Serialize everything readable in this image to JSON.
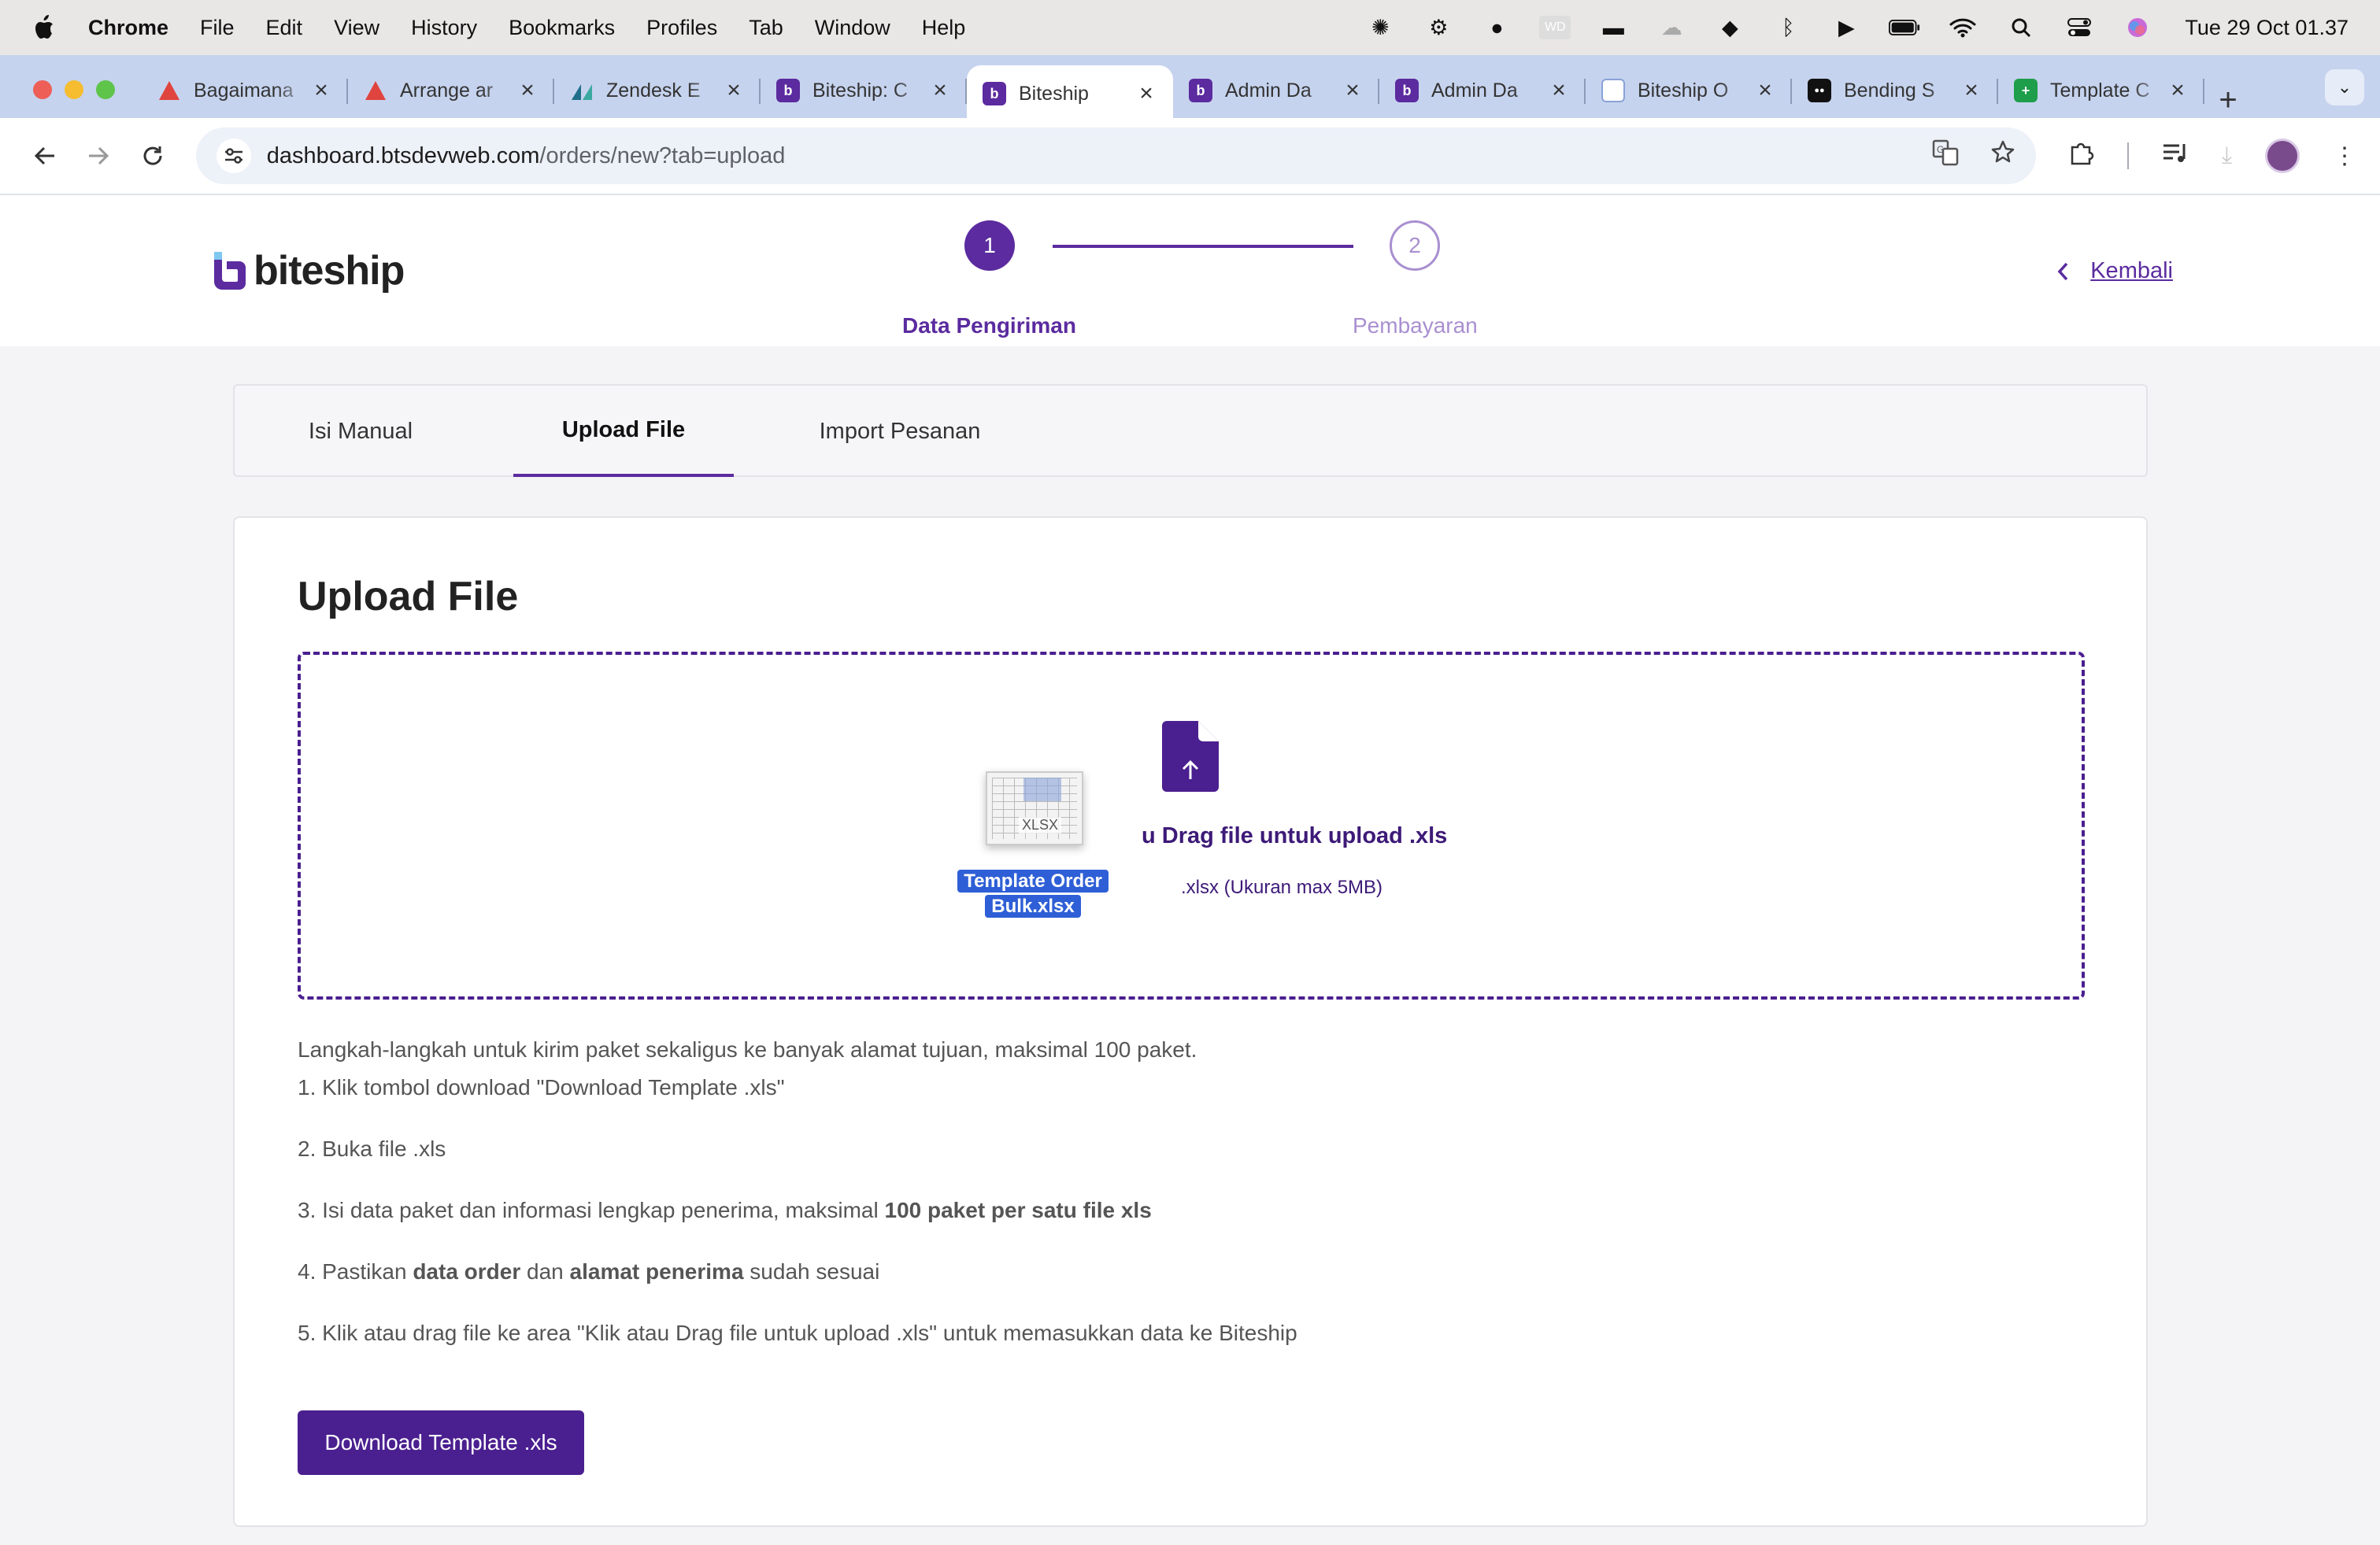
{
  "menubar": {
    "app": "Chrome",
    "items": [
      "File",
      "Edit",
      "View",
      "History",
      "Bookmarks",
      "Profiles",
      "Tab",
      "Window",
      "Help"
    ],
    "clock": "Tue 29 Oct  01.37"
  },
  "browser": {
    "tabs": [
      {
        "title": "Bagaimana",
        "icon": "red-triangle-icon",
        "color": "#e0443e"
      },
      {
        "title": "Arrange ar",
        "icon": "red-triangle-icon",
        "color": "#e0443e"
      },
      {
        "title": "Zendesk E",
        "icon": "zendesk-icon",
        "color": "#3aa9a0"
      },
      {
        "title": "Biteship: C",
        "icon": "biteship-icon",
        "color": "#5b2b9f"
      },
      {
        "title": "Biteship",
        "icon": "biteship-icon",
        "color": "#5b2b9f",
        "active": true
      },
      {
        "title": "Admin Da",
        "icon": "biteship-icon",
        "color": "#5b2b9f"
      },
      {
        "title": "Admin Da",
        "icon": "biteship-icon",
        "color": "#5b2b9f"
      },
      {
        "title": "Biteship O",
        "icon": "doc-icon",
        "color": "#8aa2d8"
      },
      {
        "title": "Bending S",
        "icon": "medium-icon",
        "color": "#111111"
      },
      {
        "title": "Template C",
        "icon": "sheets-icon",
        "color": "#1e9e4a"
      }
    ],
    "url_host": "dashboard.btsdevweb.com",
    "url_path": "/orders/new?tab=upload"
  },
  "header": {
    "logo_text": "biteship",
    "steps": [
      {
        "number": "1",
        "label": "Data Pengiriman",
        "state": "active"
      },
      {
        "number": "2",
        "label": "Pembayaran",
        "state": "pending"
      }
    ],
    "back_label": "Kembali"
  },
  "page_tabs": {
    "manual": "Isi Manual",
    "upload": "Upload File",
    "import": "Import Pesanan"
  },
  "upload": {
    "title": "Upload File",
    "drop_main": "u Drag file untuk upload .xls",
    "drop_sub": ".xlsx (Ukuran max 5MB)",
    "drag_file_name_line1": "Template Order",
    "drag_file_name_line2": "Bulk.xlsx",
    "drag_file_ext": "XLSX"
  },
  "instructions": {
    "intro": "Langkah-langkah untuk kirim paket sekaligus ke banyak alamat tujuan, maksimal 100 paket.",
    "step1": "1. Klik tombol download \"Download Template .xls\"",
    "step2": "2. Buka file .xls",
    "step3_pre": "3. Isi data paket dan informasi lengkap penerima, maksimal ",
    "step3_bold": "100 paket per satu file xls",
    "step4_pre": "4. Pastikan ",
    "step4_bold1": "data order",
    "step4_mid": " dan ",
    "step4_bold2": "alamat penerima",
    "step4_post": " sudah sesuai",
    "step5": "5. Klik atau drag file ke area \"Klik atau Drag file untuk upload .xls\" untuk memasukkan data ke Biteship"
  },
  "download_button": "Download Template .xls",
  "colors": {
    "brand": "#5b2b9f",
    "brand_dark": "#4a1f8f",
    "step_pending": "#a98fd0"
  }
}
